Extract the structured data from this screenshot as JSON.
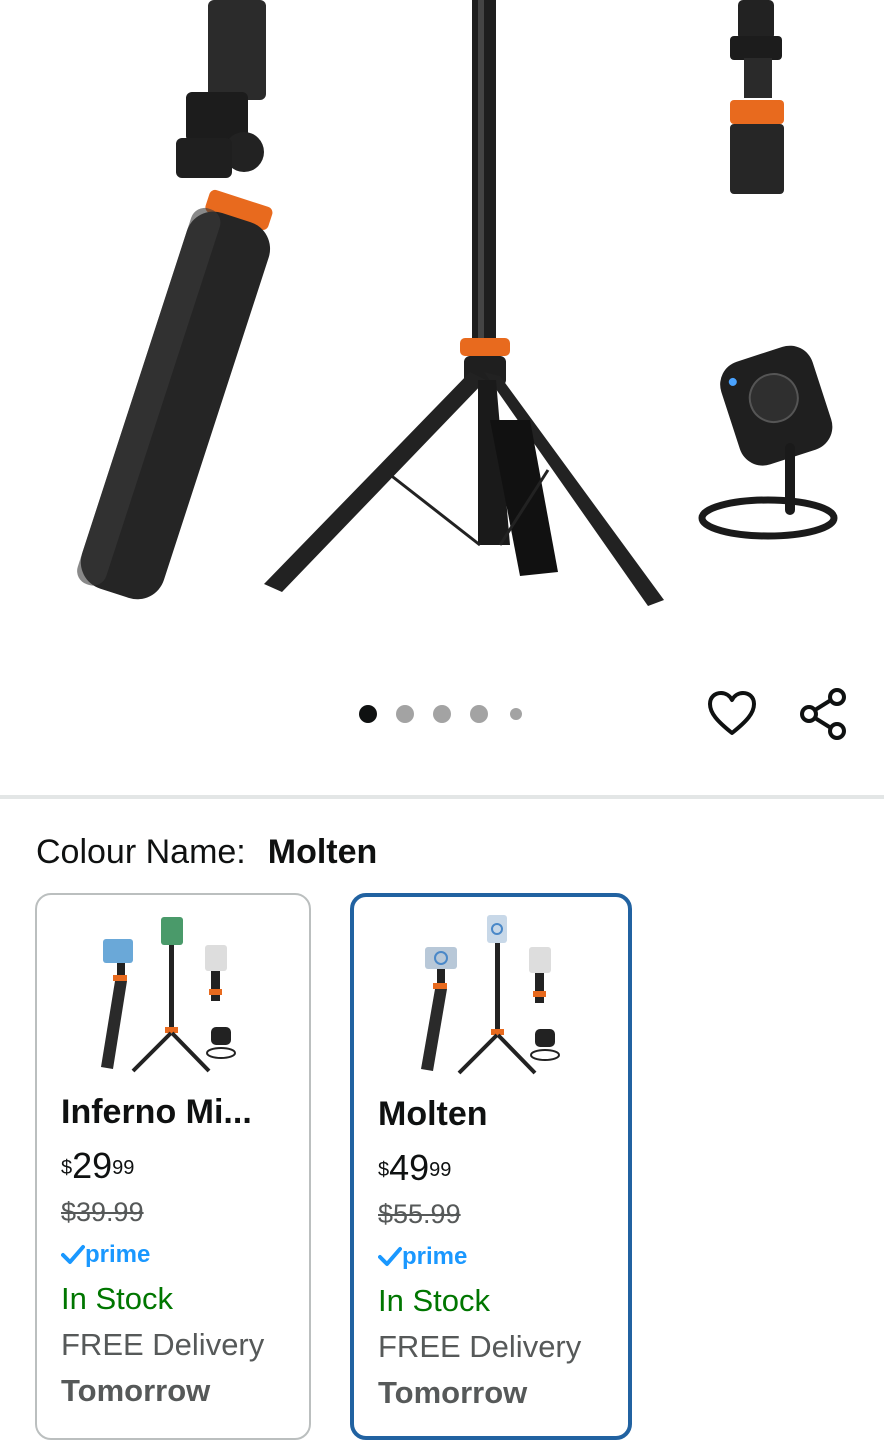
{
  "gallery": {
    "dot_count": 5,
    "active_index": 0,
    "wishlist_icon": "heart-icon",
    "share_icon": "share-icon"
  },
  "colour": {
    "label": "Colour Name:",
    "value": "Molten"
  },
  "variants": [
    {
      "name": "Inferno Mi...",
      "price_symbol": "$",
      "price_whole": "29",
      "price_fraction": "99",
      "list_price": "$39.99",
      "prime": "prime",
      "stock": "In Stock",
      "delivery": "FREE Delivery",
      "delivery_when": "Tomorrow",
      "selected": false
    },
    {
      "name": "Molten",
      "price_symbol": "$",
      "price_whole": "49",
      "price_fraction": "99",
      "list_price": "$55.99",
      "prime": "prime",
      "stock": "In Stock",
      "delivery": "FREE Delivery",
      "delivery_when": "Tomorrow",
      "selected": true
    }
  ],
  "colors": {
    "accent_orange": "#e86a1e",
    "prime_blue": "#1a98ff",
    "stock_green": "#007600",
    "selected_border": "#2162a1"
  }
}
